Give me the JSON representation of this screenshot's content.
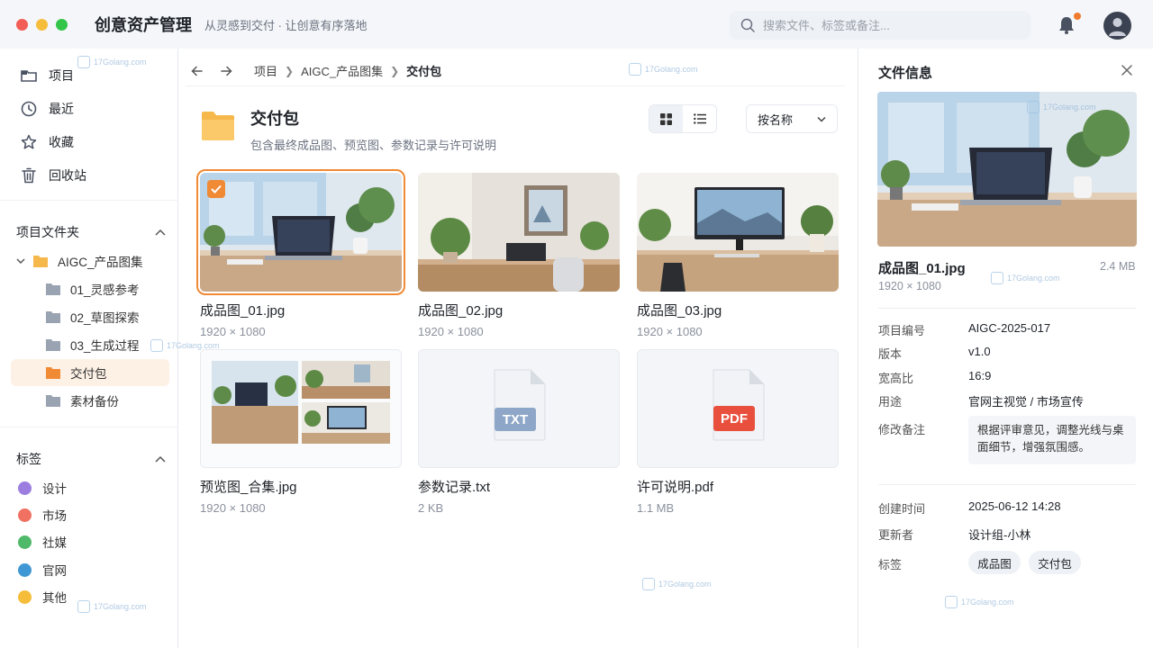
{
  "app": {
    "title": "创意资产管理",
    "subtitle": "从灵感到交付 · 让创意有序落地"
  },
  "search": {
    "placeholder": "搜索文件、标签或备注..."
  },
  "sidebar": {
    "nav": [
      {
        "label": "项目",
        "icon": "folder-icon"
      },
      {
        "label": "最近",
        "icon": "clock-icon"
      },
      {
        "label": "收藏",
        "icon": "star-icon"
      },
      {
        "label": "回收站",
        "icon": "trash-icon"
      }
    ],
    "folders_header": "项目文件夹",
    "folders": [
      {
        "label": "AIGC_产品图集"
      },
      {
        "label": "01_灵感参考"
      },
      {
        "label": "02_草图探索"
      },
      {
        "label": "03_生成过程"
      },
      {
        "label": "交付包"
      },
      {
        "label": "素材备份"
      }
    ],
    "tags_header": "标签",
    "tags": [
      {
        "label": "设计",
        "color": "#9b7ee0"
      },
      {
        "label": "市场",
        "color": "#f07162"
      },
      {
        "label": "社媒",
        "color": "#4fb96a"
      },
      {
        "label": "官网",
        "color": "#3f98d4"
      },
      {
        "label": "其他",
        "color": "#f5bd3a"
      }
    ]
  },
  "breadcrumb": [
    "项目",
    "AIGC_产品图集",
    "交付包"
  ],
  "folder": {
    "title": "交付包",
    "description": "包含最终成品图、预览图、参数记录与许可说明"
  },
  "sort": {
    "label": "按名称"
  },
  "files": [
    {
      "name": "成品图_01.jpg",
      "meta": "1920 × 1080"
    },
    {
      "name": "成品图_02.jpg",
      "meta": "1920 × 1080"
    },
    {
      "name": "成品图_03.jpg",
      "meta": "1920 × 1080"
    },
    {
      "name": "预览图_合集.jpg",
      "meta": "1920 × 1080"
    },
    {
      "name": "参数记录.txt",
      "meta": "2 KB",
      "badge": "TXT"
    },
    {
      "name": "许可说明.pdf",
      "meta": "1.1 MB",
      "badge": "PDF"
    }
  ],
  "panel": {
    "title": "文件信息",
    "file_name": "成品图_01.jpg",
    "file_size": "2.4 MB",
    "file_dim": "1920 × 1080",
    "props": [
      {
        "label": "项目编号",
        "value": "AIGC-2025-017"
      },
      {
        "label": "版本",
        "value": "v1.0"
      },
      {
        "label": "宽高比",
        "value": "16:9"
      },
      {
        "label": "用途",
        "value": "官网主视觉 / 市场宣传"
      }
    ],
    "note_label": "修改备注",
    "note": "根据评审意见，调整光线与桌面细节，增强氛围感。",
    "created_label": "创建时间",
    "created": "2025-06-12  14:28",
    "updater_label": "更新者",
    "updater": "设计组-小林",
    "tags_label": "标签",
    "tags": [
      "成品图",
      "交付包"
    ]
  },
  "watermark": "17Golang.com",
  "colors": {
    "accent": "#f08a35",
    "folder": "#f6b84b"
  }
}
